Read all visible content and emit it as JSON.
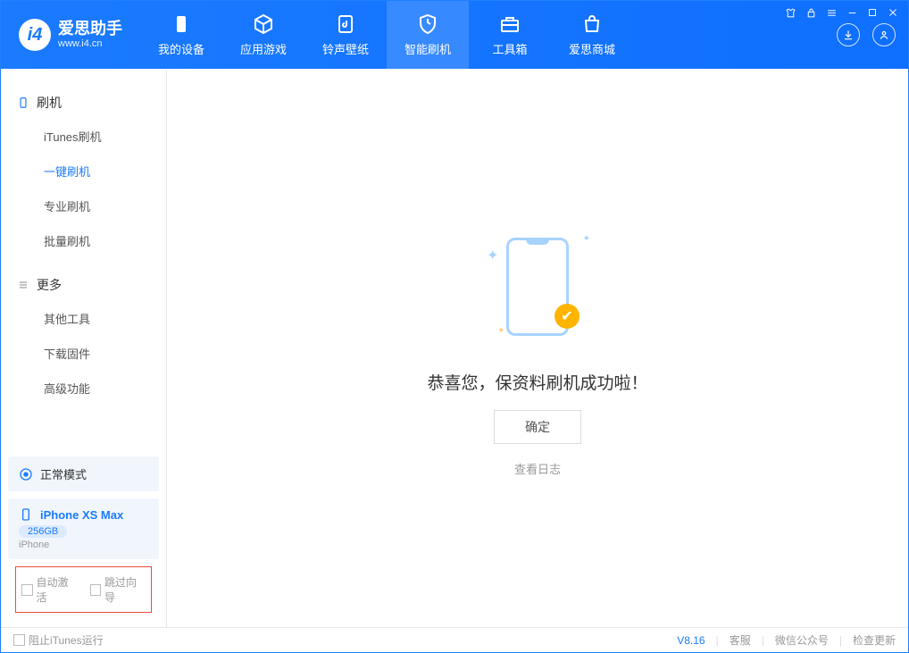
{
  "app": {
    "name": "爱思助手",
    "site": "www.i4.cn"
  },
  "tabs": {
    "device": "我的设备",
    "apps": "应用游戏",
    "ringtones": "铃声壁纸",
    "flash": "智能刷机",
    "toolbox": "工具箱",
    "store": "爱思商城"
  },
  "sidebar": {
    "group_flash": "刷机",
    "items_flash": {
      "itunes": "iTunes刷机",
      "oneclick": "一键刷机",
      "pro": "专业刷机",
      "batch": "批量刷机"
    },
    "group_more": "更多",
    "items_more": {
      "other_tools": "其他工具",
      "download_fw": "下载固件",
      "advanced": "高级功能"
    },
    "mode": "正常模式",
    "device": {
      "name": "iPhone XS Max",
      "capacity": "256GB",
      "type": "iPhone"
    },
    "options": {
      "auto_activate": "自动激活",
      "skip_guide": "跳过向导"
    }
  },
  "main": {
    "success": "恭喜您，保资料刷机成功啦！",
    "ok_button": "确定",
    "view_log": "查看日志"
  },
  "footer": {
    "block_itunes": "阻止iTunes运行",
    "version": "V8.16",
    "support": "客服",
    "wechat": "微信公众号",
    "check_update": "检查更新"
  }
}
